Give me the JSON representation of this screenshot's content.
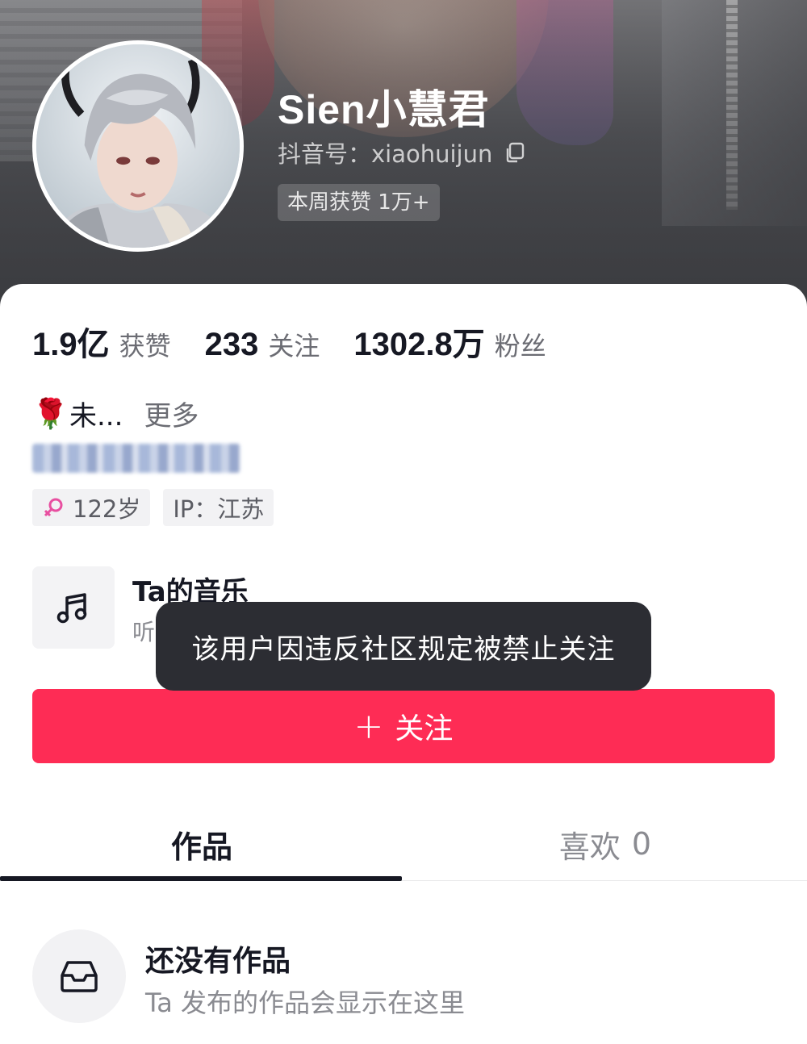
{
  "profile": {
    "nickname": "Sien小慧君",
    "douyin_id": "抖音号：xiaohuijun",
    "weekly_likes_badge": "本周获赞 1万+"
  },
  "stats": {
    "likes_value": "1.9亿",
    "likes_label": "获赞",
    "following_value": "233",
    "following_label": "关注",
    "followers_value": "1302.8万",
    "followers_label": "粉丝"
  },
  "bio": {
    "emoji": "🌹",
    "text": "未...",
    "more": "更多"
  },
  "tags": {
    "age": "122岁",
    "ip": "IP：江苏"
  },
  "music": {
    "title": "Ta的音乐",
    "subtitle_visible": "听"
  },
  "toast": {
    "message": "该用户因违反社区规定被禁止关注"
  },
  "follow_button": {
    "plus": "+",
    "label": "关注"
  },
  "tabs": {
    "works": "作品",
    "likes": "喜欢",
    "likes_count": "0"
  },
  "empty_state": {
    "title": "还没有作品",
    "subtitle": "Ta 发布的作品会显示在这里"
  },
  "colors": {
    "accent": "#fe2c55",
    "toast_bg": "#2c2d33",
    "gender_icon": "#e84fa0"
  }
}
